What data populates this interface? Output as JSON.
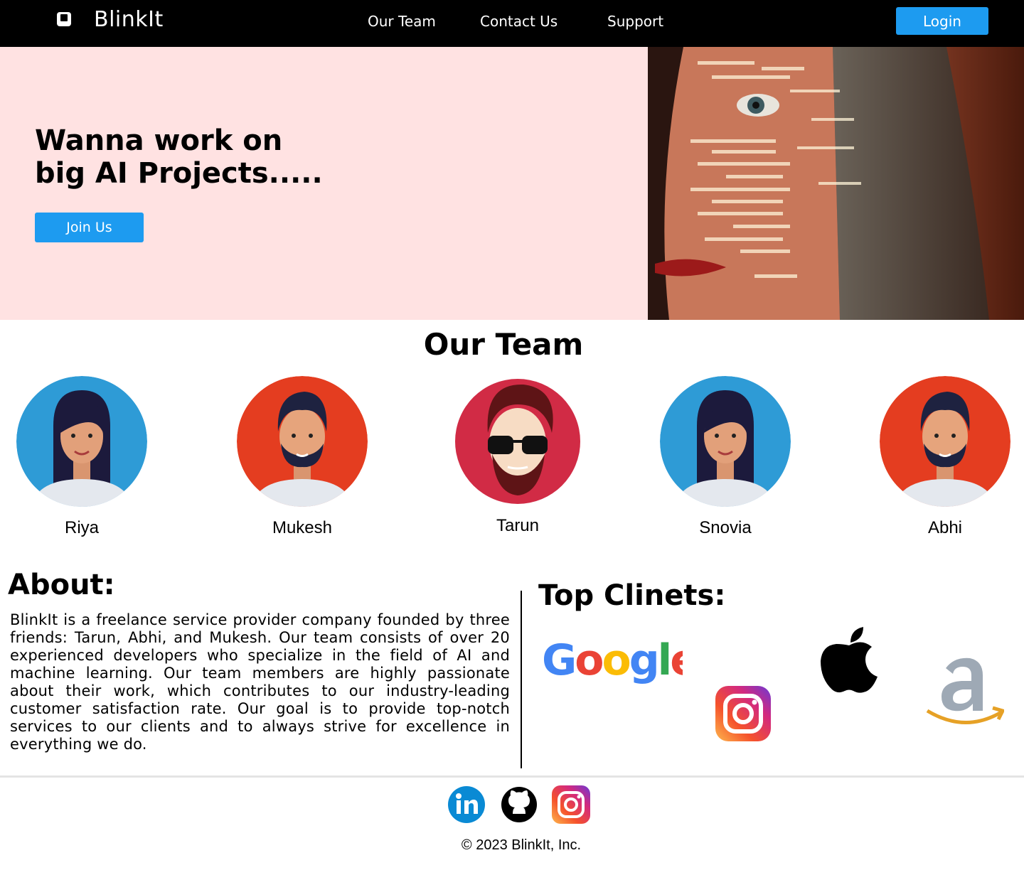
{
  "navbar": {
    "brand": "BlinkIt",
    "links": [
      "Our Team",
      "Contact Us",
      "Support"
    ],
    "login_label": "Login",
    "accent_color": "#1d9bf0"
  },
  "hero": {
    "title_line1": "Wanna work on",
    "title_line2": "big AI Projects.....",
    "join_label": "Join Us",
    "background": "#ffe2e2"
  },
  "team": {
    "title": "Our Team",
    "members": [
      {
        "name": "Riya",
        "avatar": "female-avatar-blue"
      },
      {
        "name": "Mukesh",
        "avatar": "male-avatar-red"
      },
      {
        "name": "Tarun",
        "avatar": "male-avatar-sunglasses"
      },
      {
        "name": "Snovia",
        "avatar": "female-avatar-blue"
      },
      {
        "name": "Abhi",
        "avatar": "male-avatar-red"
      }
    ]
  },
  "about": {
    "title": "About:",
    "text": "BlinkIt is a freelance service provider company founded by three friends: Tarun, Abhi, and Mukesh. Our team consists of over 20 experienced developers who specialize in the field of AI and machine learning. Our team members are highly passionate about their work, which contributes to our industry-leading customer satisfaction rate. Our goal is to provide top-notch services to our clients and to always strive for excellence in everything we do."
  },
  "clients": {
    "title": "Top Clinets:",
    "logos": [
      "Google",
      "instagram-logo",
      "apple-logo",
      "amazon-logo"
    ]
  },
  "footer": {
    "socials": [
      "linkedin-icon",
      "github-icon",
      "instagram-icon"
    ],
    "copyright": "© 2023 BlinkIt, Inc."
  }
}
